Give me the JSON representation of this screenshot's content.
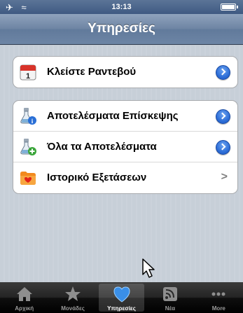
{
  "status_bar": {
    "time": "13:13"
  },
  "nav": {
    "title": "Υπηρεσίες"
  },
  "group1": {
    "rows": [
      {
        "label": "Κλείστε Ραντεβού",
        "icon": "calendar-icon",
        "accessory": "detail-disclosure"
      }
    ]
  },
  "group2": {
    "rows": [
      {
        "label": "Αποτελέσματα Επίσκεψης",
        "icon": "flask-info-icon",
        "accessory": "detail-disclosure"
      },
      {
        "label": "Όλα τα Αποτελέσματα",
        "icon": "flask-add-icon",
        "accessory": "detail-disclosure"
      },
      {
        "label": "Ιστορικό Εξετάσεων",
        "icon": "folder-icon",
        "accessory": "chevron"
      }
    ]
  },
  "calendar_icon_day": "1",
  "tabs": [
    {
      "label": "Αρχική",
      "icon": "home-icon",
      "selected": false
    },
    {
      "label": "Μονάδες",
      "icon": "star-icon",
      "selected": false
    },
    {
      "label": "Υπηρεσίες",
      "icon": "heart-icon",
      "selected": true
    },
    {
      "label": "Νέα",
      "icon": "rss-icon",
      "selected": false
    },
    {
      "label": "More",
      "icon": "more-icon",
      "selected": false
    }
  ],
  "colors": {
    "nav_bar": "#6d84a3",
    "disclosure_blue": "#2e6fd8",
    "heart_blue": "#3a8fe8",
    "background": "#c5ccd4"
  }
}
